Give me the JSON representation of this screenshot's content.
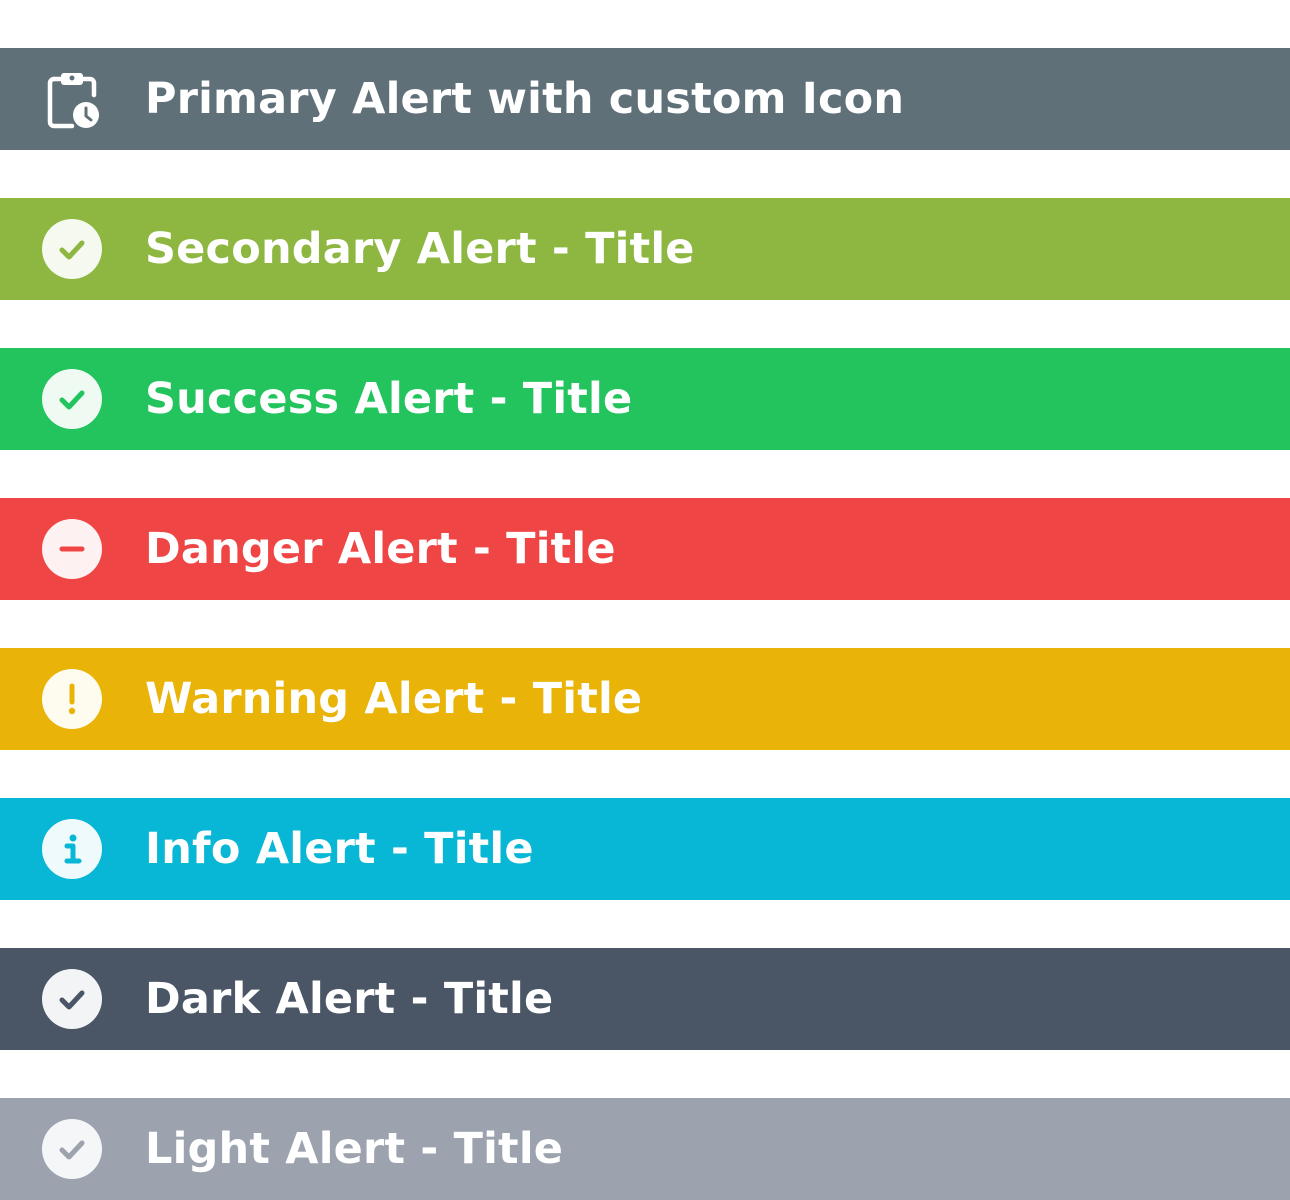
{
  "alerts": [
    {
      "id": "primary",
      "title": "Primary Alert with custom Icon",
      "icon": "clipboard-clock-icon",
      "color": "#607079"
    },
    {
      "id": "secondary",
      "title": "Secondary Alert - Title",
      "icon": "check-circle-icon",
      "color": "#8DB741"
    },
    {
      "id": "success",
      "title": "Success Alert - Title",
      "icon": "check-circle-icon",
      "color": "#23C45E"
    },
    {
      "id": "danger",
      "title": "Danger Alert - Title",
      "icon": "minus-circle-icon",
      "color": "#EF4545"
    },
    {
      "id": "warning",
      "title": "Warning Alert - Title",
      "icon": "exclamation-circle-icon",
      "color": "#E9B308"
    },
    {
      "id": "info",
      "title": "Info Alert - Title",
      "icon": "info-circle-icon",
      "color": "#08B6D5"
    },
    {
      "id": "dark",
      "title": "Dark Alert - Title",
      "icon": "check-circle-icon",
      "color": "#4A5565"
    },
    {
      "id": "light",
      "title": "Light Alert - Title",
      "icon": "check-circle-icon",
      "color": "#9CA3AE"
    }
  ]
}
